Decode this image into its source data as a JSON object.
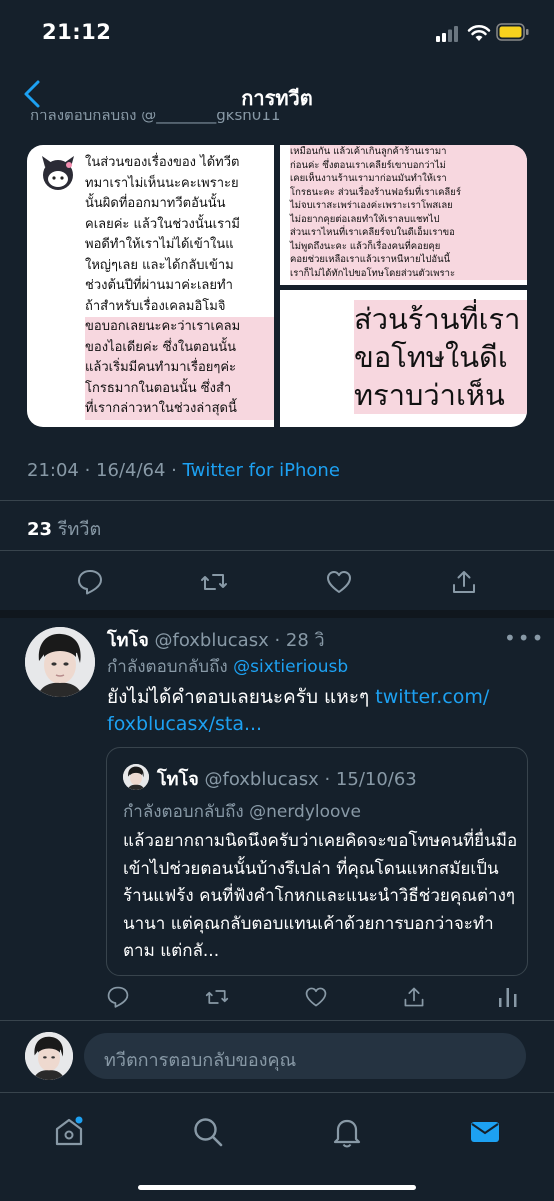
{
  "status_bar": {
    "time": "21:12"
  },
  "nav": {
    "title": "การทวีต",
    "back_icon": "chevron-left-icon"
  },
  "tweet": {
    "cut_line": "กำลังตอบกลับถึง @________gksh011",
    "media": {
      "left_lines": [
        "ในส่วนของเรื่องของ ได้ทวีต",
        "ทมาเราไม่เห็นนะคะเพราะย",
        "นั้นผิดที่ออกมาทวีตอันนั้น",
        "คเลยค่ะ แล้วในช่วงนั้นเรามี",
        "พอดีทำให้เราไม่ได้เข้าในแ",
        "ใหญ่ๆเลย และได้กลับเข้าม",
        "ช่วงต้นปีที่ผ่านมาค่ะเลยทำ",
        "ถ้าสำหรับเรื่องเคลมอิโมจิ",
        "ขอบอกเลยนะคะว่าเราเคลม",
        "ของไอเดียค่ะ ซึ่งในตอนนั้น",
        "แล้วเริ่มมีคนทำมาเรื่อยๆค่ะ",
        "โกรธมากในตอนนั้น ซึ่งสำ",
        "ที่เรากล่าวหาในช่วงล่าสุดนี้"
      ],
      "top_right_lines": [
        "เหมือนกัน แล้วเค้าเกินลูกค้าร้านเรามา",
        "ก่อนค่ะ ซึ่งตอนเราเคลียร์เขาบอกว่าไม่",
        "เคยเห็นงานร้านเรามาก่อนมันทำให้เรา",
        "โกรธนะคะ ส่วนเรื่องร้านฟอร์มที่เราเคลียร์",
        "ไม่จบเราสะเพร่าเองค่ะเพราะเราโพสเลย",
        "ไม่อยากคุยต่อเลยทำให้เราลบแชทไป",
        "ส่วนเราไหนที่เราเคลียร์จบในดีเอ็มเราขอ",
        "ไม่พูดถึงนะคะ แล้วก็เรื่องคนที่คอยคุย",
        "คอยช่วยเหลือเราแล้วเราหนีหายไปอันนี้",
        "เราก็ไม่ได้ทักไปขอโทษโดยส่วนตัวเพราะ"
      ],
      "bottom_right_lines": [
        "ส่วนร้านที่เรา",
        "ขอโทษในดีเ",
        "ทราบว่าเห็น"
      ]
    },
    "meta": {
      "time": "21:04",
      "sep": " · ",
      "date": "16/4/64",
      "client": "Twitter for iPhone"
    },
    "retweets": {
      "count": "23",
      "label": "รีทวีต"
    },
    "actions": [
      "reply-icon",
      "retweet-icon",
      "like-icon",
      "share-icon"
    ]
  },
  "reply": {
    "name": "โทโจ",
    "handle": "@foxblucasx",
    "time": "· 28 วิ",
    "more": "•••",
    "replying_prefix": "กำลังตอบกลับถึง",
    "replying_to": "@sixtieriousb",
    "text": "ยังไม่ได้คำตอบเลยนะครับ แหะๆ",
    "link": "twitter.com/ foxblucasx/sta...",
    "quote": {
      "name": "โทโจ",
      "handle": "@foxblucasx",
      "date": "· 15/10/63",
      "replying_prefix": "กำลังตอบกลับถึง",
      "replying_to": "@nerdyloove",
      "text": "แล้วอยากถามนิดนึงครับว่าเคยคิดจะขอโทษคนที่ยื่นมือเข้าไปช่วยตอนนั้นบ้างรึเปล่า ที่คุณโดนแหกสมัยเป็นร้านแฟร้ง คนที่ฟังคำโกหกและแนะนำวิธีช่วยคุณต่างๆนานา แต่คุณกลับตอบแทนเค้าด้วยการบอกว่าจะทำตาม แต่กลั..."
    },
    "actions": [
      "reply-icon",
      "retweet-icon",
      "like-icon",
      "share-icon",
      "analytics-icon"
    ]
  },
  "compose": {
    "placeholder": "ทวีตการตอบกลับของคุณ"
  },
  "tabbar": {
    "tabs": [
      "home-icon",
      "search-icon",
      "notifications-icon",
      "messages-icon"
    ],
    "accent": "#1da1f2"
  },
  "colors": {
    "background": "#15202b",
    "accent": "#1da1f2",
    "muted": "#8899a6",
    "border": "#38444d"
  }
}
